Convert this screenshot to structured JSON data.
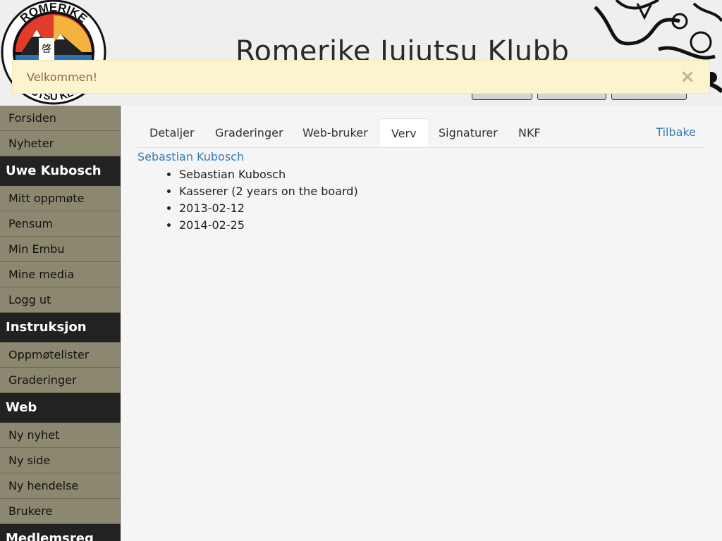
{
  "header": {
    "title": "Romerike Jujutsu Klubb",
    "logo_text_top": "ROMERIKE",
    "logo_text_bottom": "JUJUTSU KLUBB",
    "logo_kanji": "啓"
  },
  "alert": {
    "message": "Velkommen!",
    "close_glyph": "×"
  },
  "sidebar": {
    "items_top": [
      "Forsiden",
      "Nyheter"
    ],
    "sections": [
      {
        "heading": "Uwe Kubosch",
        "items": [
          "Mitt oppmøte",
          "Pensum",
          "Min Embu",
          "Mine media",
          "Logg ut"
        ]
      },
      {
        "heading": "Instruksjon",
        "items": [
          "Oppmøtelister",
          "Graderinger"
        ]
      },
      {
        "heading": "Web",
        "items": [
          "Ny nyhet",
          "Ny side",
          "Ny hendelse",
          "Brukere"
        ]
      },
      {
        "heading": "Medlemsreg",
        "items": []
      }
    ]
  },
  "tabs": [
    "Detaljer",
    "Graderinger",
    "Web-bruker",
    "Verv",
    "Signaturer",
    "NKF"
  ],
  "active_tab": "Verv",
  "back_link": "Tilbake",
  "member": {
    "name_link": "Sebastian Kubosch",
    "details": [
      "Sebastian Kubosch",
      "Kasserer (2 years on the board)",
      "2013-02-12",
      "2014-02-25"
    ]
  },
  "colors": {
    "sidebar_item_bg": "#8c8870",
    "sidebar_heading_bg": "#222222",
    "alert_bg": "#fcf3cf",
    "link": "#337ab7"
  }
}
